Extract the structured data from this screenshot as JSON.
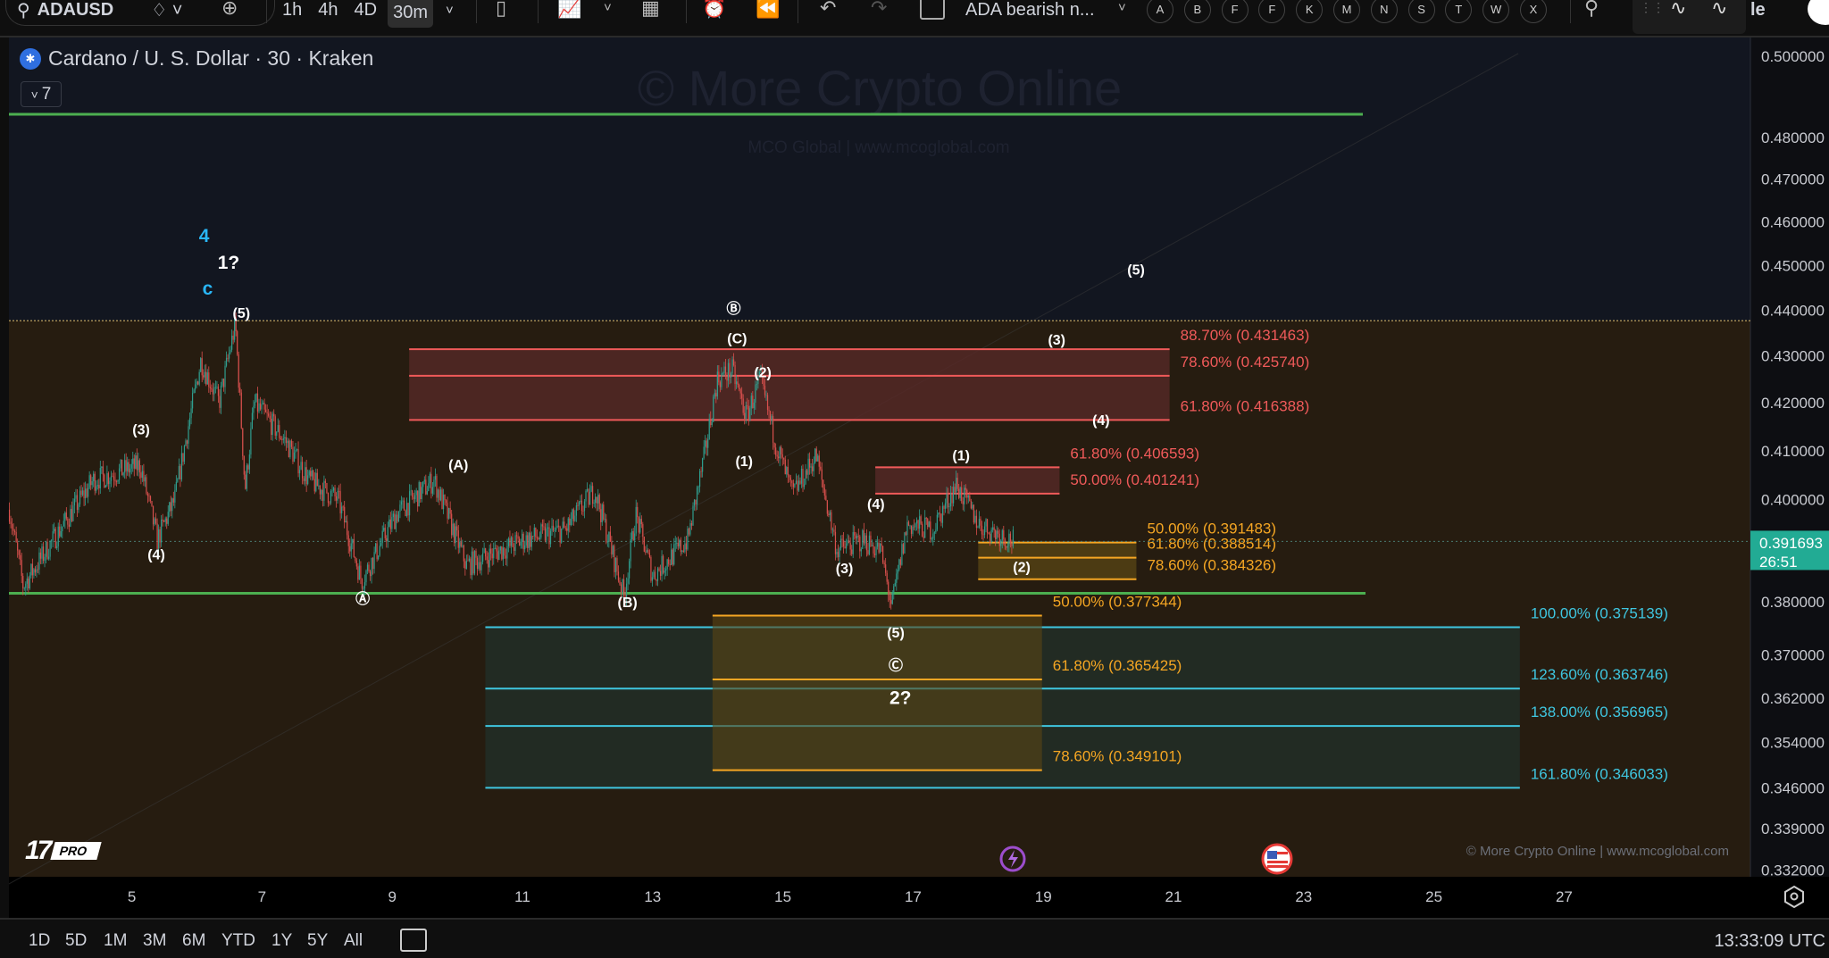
{
  "toolbar": {
    "symbol": "ADAUSD",
    "intervals": [
      "1h",
      "4h",
      "4D",
      "30m"
    ],
    "active_interval": "30m",
    "layout_name": "ADA bearish n...",
    "hotkeys": [
      "A",
      "B",
      "F",
      "F",
      "K",
      "M",
      "N",
      "S",
      "T",
      "W",
      "X"
    ],
    "cut_button": "le"
  },
  "legend": {
    "title": "Cardano / U. S. Dollar · 30 · Kraken",
    "indicator_count": "7"
  },
  "watermark": {
    "main": "© More Crypto Online",
    "sub": "MCO Global  |  www.mcoglobal.com",
    "footer": "© More Crypto Online  |  www.mcoglobal.com"
  },
  "logo": {
    "pro": "PRO",
    "mark": "TV"
  },
  "colors": {
    "up": "#26a69a",
    "down": "#ef5350",
    "support_line": "#4caf50",
    "fib_red": "#f05a5a",
    "fib_orange": "#f5a623",
    "fib_cyan": "#3fc6e0",
    "price_badge": "#22ab94"
  },
  "price_axis": {
    "scale": "log",
    "labels": [
      "0.500000",
      "0.480000",
      "0.470000",
      "0.460000",
      "0.450000",
      "0.440000",
      "0.430000",
      "0.420000",
      "0.410000",
      "0.400000",
      "0.380000",
      "0.370000",
      "0.362000",
      "0.354000",
      "0.346000",
      "0.339000",
      "0.332000"
    ],
    "current_price": "0.391693",
    "countdown": "26:51"
  },
  "time_axis": {
    "labels": [
      "5",
      "7",
      "9",
      "11",
      "13",
      "15",
      "17",
      "19",
      "21",
      "23",
      "25",
      "27"
    ]
  },
  "chart_data": {
    "type": "candlestick",
    "series_pivots_day_price": [
      [
        3.12,
        0.398
      ],
      [
        3.33,
        0.383
      ],
      [
        4.41,
        0.404
      ],
      [
        5.13,
        0.407
      ],
      [
        5.39,
        0.392
      ],
      [
        5.66,
        0.4
      ],
      [
        6.06,
        0.429
      ],
      [
        6.34,
        0.42
      ],
      [
        6.59,
        0.437
      ],
      [
        6.74,
        0.402
      ],
      [
        6.88,
        0.42
      ],
      [
        7.36,
        0.412
      ],
      [
        7.72,
        0.404
      ],
      [
        8.17,
        0.4
      ],
      [
        8.53,
        0.384
      ],
      [
        9.06,
        0.397
      ],
      [
        9.64,
        0.404
      ],
      [
        10.14,
        0.387
      ],
      [
        11.03,
        0.392
      ],
      [
        11.66,
        0.394
      ],
      [
        12.11,
        0.402
      ],
      [
        12.56,
        0.381
      ],
      [
        12.74,
        0.397
      ],
      [
        13.0,
        0.385
      ],
      [
        13.54,
        0.392
      ],
      [
        13.81,
        0.41
      ],
      [
        13.99,
        0.425
      ],
      [
        14.22,
        0.427
      ],
      [
        14.44,
        0.417
      ],
      [
        14.65,
        0.425
      ],
      [
        14.88,
        0.412
      ],
      [
        15.15,
        0.401
      ],
      [
        15.51,
        0.409
      ],
      [
        15.83,
        0.39
      ],
      [
        16.23,
        0.392
      ],
      [
        16.5,
        0.39
      ],
      [
        16.67,
        0.379
      ],
      [
        16.91,
        0.395
      ],
      [
        17.3,
        0.394
      ],
      [
        17.66,
        0.403
      ],
      [
        18.02,
        0.395
      ],
      [
        18.55,
        0.391693
      ]
    ],
    "horizontal_lines": {
      "resistance_top": 0.4856,
      "support": 0.3816,
      "prior_high_dotted": 0.4377
    }
  },
  "fibs": {
    "red_upper": [
      {
        "label": "88.70% (0.431463)",
        "price": 0.431463
      },
      {
        "label": "78.60% (0.425740)",
        "price": 0.42574
      },
      {
        "label": "61.80% (0.416388)",
        "price": 0.416388
      }
    ],
    "red_lower": [
      {
        "label": "61.80% (0.406593)",
        "price": 0.406593
      },
      {
        "label": "50.00% (0.401241)",
        "price": 0.401241
      }
    ],
    "orange_upper": [
      {
        "label": "50.00% (0.391483)",
        "price": 0.391483
      },
      {
        "label": "61.80% (0.388514)",
        "price": 0.388514
      },
      {
        "label": "78.60% (0.384326)",
        "price": 0.384326
      }
    ],
    "orange_lower": [
      {
        "label": "50.00% (0.377344)",
        "price": 0.377344
      },
      {
        "label": "61.80% (0.365425)",
        "price": 0.365425
      },
      {
        "label": "78.60% (0.349101)",
        "price": 0.349101
      }
    ],
    "cyan": [
      {
        "label": "100.00% (0.375139)",
        "price": 0.375139
      },
      {
        "label": "123.60% (0.363746)",
        "price": 0.363746
      },
      {
        "label": "138.00% (0.356965)",
        "price": 0.356965
      },
      {
        "label": "161.80% (0.346033)",
        "price": 0.346033
      }
    ]
  },
  "wave_labels": [
    {
      "text": "4",
      "color": "#29b6f6"
    },
    {
      "text": "1?",
      "color": "#ffffff"
    },
    {
      "text": "c",
      "color": "#29b6f6"
    },
    {
      "text": "(5)",
      "color": "#ffffff"
    },
    {
      "text": "(3)",
      "color": "#ffffff"
    },
    {
      "text": "(4)",
      "color": "#ffffff"
    },
    {
      "text": "Ⓐ",
      "color": "#ffffff"
    },
    {
      "text": "(A)",
      "color": "#ffffff"
    },
    {
      "text": "(B)",
      "color": "#ffffff"
    },
    {
      "text": "Ⓑ",
      "color": "#ffffff"
    },
    {
      "text": "(C)",
      "color": "#ffffff"
    },
    {
      "text": "(2)",
      "color": "#ffffff"
    },
    {
      "text": "(1)",
      "color": "#ffffff"
    },
    {
      "text": "(4)",
      "color": "#ffffff"
    },
    {
      "text": "(3)",
      "color": "#ffffff"
    },
    {
      "text": "(5)",
      "color": "#ffffff"
    },
    {
      "text": "Ⓒ",
      "color": "#ffffff"
    },
    {
      "text": "2?",
      "color": "#ffffff"
    },
    {
      "text": "(1)",
      "color": "#ffffff"
    },
    {
      "text": "(2)",
      "color": "#ffffff"
    },
    {
      "text": "(3)",
      "color": "#ffffff"
    },
    {
      "text": "(4)",
      "color": "#ffffff"
    },
    {
      "text": "(5)",
      "color": "#ffffff"
    }
  ],
  "bottom_bar": {
    "ranges": [
      "1D",
      "5D",
      "1M",
      "3M",
      "6M",
      "YTD",
      "1Y",
      "5Y",
      "All"
    ],
    "clock": "13:33:09 UTC"
  }
}
